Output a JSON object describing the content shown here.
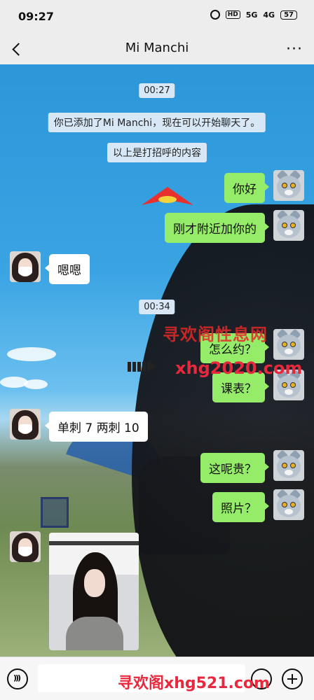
{
  "status_bar": {
    "time": "09:27",
    "hd": "HD",
    "signal_1": "5G",
    "signal_2": "4G",
    "battery": "57"
  },
  "header": {
    "title": "Mi Manchi",
    "more_label": "···"
  },
  "chat": {
    "timestamp_1": "00:27",
    "system_added": "你已添加了Mi Manchi，现在可以开始聊天了。",
    "system_greeting": "以上是打招呼的内容",
    "timestamp_2": "00:34",
    "messages": [
      {
        "side": "out",
        "text": "你好"
      },
      {
        "side": "out",
        "text": "刚才附近加你的"
      },
      {
        "side": "in",
        "text": "嗯嗯"
      },
      {
        "side": "out",
        "text": "怎么约？"
      },
      {
        "side": "out",
        "text": "课表？"
      },
      {
        "side": "in",
        "text": "单刺 7 两刺 10"
      },
      {
        "side": "out",
        "text": "这呢贵？"
      },
      {
        "side": "out",
        "text": "照片？"
      },
      {
        "side": "in",
        "type": "image"
      }
    ]
  },
  "watermarks": {
    "site_cn": "寻欢阁性息网",
    "site_url": "xhg2020.com",
    "bottom": "寻欢阁xhg521.com"
  },
  "input_bar": {
    "placeholder": ""
  },
  "colors": {
    "outgoing_bubble": "#95ec69",
    "incoming_bubble": "#ffffff",
    "watermark_red": "#e8283c"
  }
}
